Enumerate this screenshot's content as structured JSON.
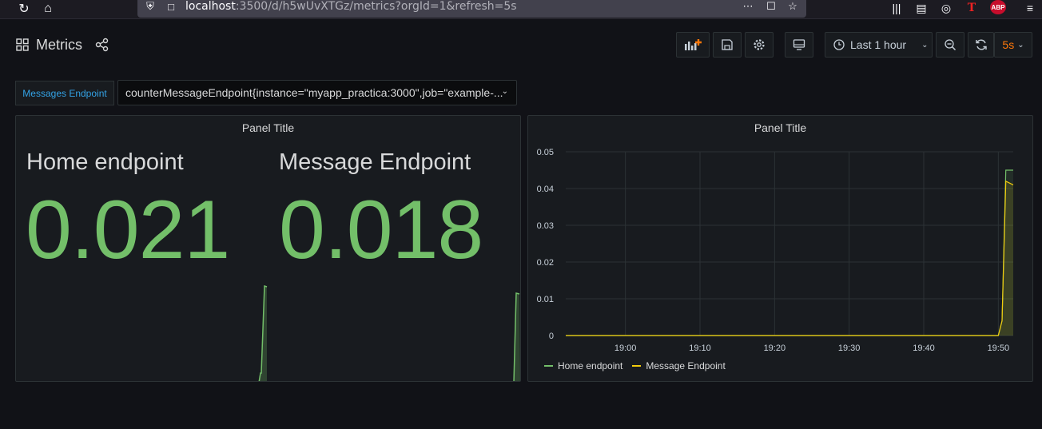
{
  "browser": {
    "url_host": "localhost",
    "url_rest": ":3500/d/h5wUvXTGz/metrics?orgId=1&refresh=5s",
    "abp_label": "ABP"
  },
  "header": {
    "title": "Metrics",
    "time_range": "Last 1 hour",
    "refresh_interval": "5s"
  },
  "variable": {
    "label": "Messages Endpoint",
    "value": "counterMessageEndpoint{instance=\"myapp_practica:3000\",job=\"example-..."
  },
  "stat_panel": {
    "title": "Panel Title",
    "stats": [
      {
        "name": "Home endpoint",
        "value": "0.021"
      },
      {
        "name": "Message Endpoint",
        "value": "0.018"
      }
    ]
  },
  "graph_panel": {
    "title": "Panel Title",
    "legend": [
      {
        "name": "Home endpoint",
        "color": "#73bf69"
      },
      {
        "name": "Message Endpoint",
        "color": "#f2cc0c"
      }
    ]
  },
  "chart_data": {
    "type": "line",
    "title": "Panel Title",
    "xlabel": "",
    "ylabel": "",
    "x_ticks": [
      "19:00",
      "19:10",
      "19:20",
      "19:30",
      "19:40",
      "19:50"
    ],
    "y_ticks": [
      "0",
      "0.01",
      "0.02",
      "0.03",
      "0.04",
      "0.05"
    ],
    "ylim": [
      0,
      0.05
    ],
    "grid": true,
    "legend_position": "bottom-left",
    "series": [
      {
        "name": "Home endpoint",
        "color": "#73bf69",
        "x": [
          "18:52",
          "19:50",
          "19:50:30",
          "19:51",
          "19:52"
        ],
        "y": [
          0,
          0,
          0.004,
          0.045,
          0.045
        ]
      },
      {
        "name": "Message Endpoint",
        "color": "#f2cc0c",
        "x": [
          "18:52",
          "19:50",
          "19:50:30",
          "19:51",
          "19:52"
        ],
        "y": [
          0,
          0,
          0.004,
          0.042,
          0.041
        ]
      }
    ]
  },
  "colors": {
    "accent_orange": "#ff780a",
    "stat_green": "#73bf69",
    "var_label_blue": "#33a2e5"
  }
}
